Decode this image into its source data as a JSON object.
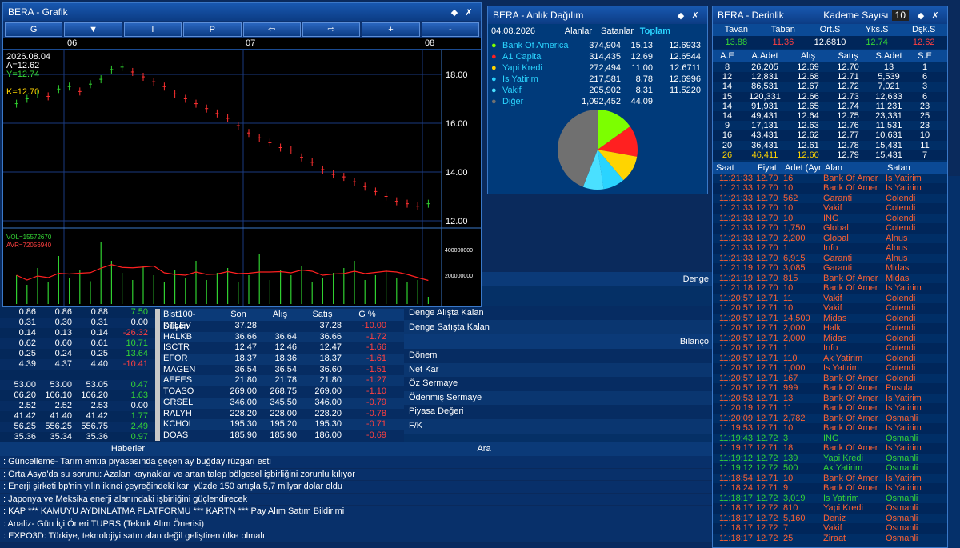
{
  "chart_win": {
    "title": "BERA - Grafik",
    "toolbar": [
      "G",
      "▼",
      "I",
      "P",
      "⇦",
      "⇨",
      "+",
      "-"
    ],
    "dates": [
      "06",
      "07",
      "08"
    ],
    "ohlc_info": {
      "date": "2026.08.04",
      "a": "A=12.62",
      "y": "Y=12.74",
      "k": "K=12.70"
    },
    "price_ticks": [
      "18.00",
      "16.00",
      "14.00",
      "12.00"
    ],
    "vol_label": "VOL=15572670",
    "avr_label": "AVR=72056940",
    "vol_ticks": [
      "400000000",
      "200000000"
    ]
  },
  "chart_data": {
    "type": "line",
    "title": "",
    "series": [
      {
        "values": [
          16.8,
          17.0,
          17.2,
          17.1,
          17.4,
          17.5,
          17.3,
          17.6,
          17.8,
          18.2,
          18.3,
          18.1,
          17.9,
          17.7,
          17.5,
          17.2,
          17.0,
          16.8,
          16.6,
          16.4,
          16.2,
          15.9,
          15.6,
          15.4,
          15.2,
          15.0,
          14.9,
          14.6,
          14.4,
          14.1,
          13.9,
          13.8,
          13.6,
          13.4,
          13.2,
          13.0,
          12.8,
          12.7,
          12.6,
          12.7
        ]
      },
      {
        "values": [
          120,
          80,
          150,
          90,
          200,
          110,
          140,
          95,
          260,
          180,
          130,
          100,
          160,
          120,
          90,
          140,
          110,
          180,
          100,
          130,
          150,
          90,
          120,
          210,
          100,
          140,
          120,
          160,
          90,
          110,
          130,
          150,
          180,
          100,
          120,
          140,
          110,
          90,
          100,
          30
        ]
      }
    ]
  },
  "dist_win": {
    "title": "BERA - Anlık Dağılım",
    "date": "04.08.2026",
    "headers": [
      "Alanlar",
      "Satanlar",
      "Toplam"
    ],
    "rows": [
      {
        "name": "Bank Of America",
        "a": "374,904",
        "b": "15.13",
        "c": "12.6933",
        "color": "#7cff00"
      },
      {
        "name": "A1 Capital",
        "a": "314,435",
        "b": "12.69",
        "c": "12.6544",
        "color": "#ff2020"
      },
      {
        "name": "Yapi Kredi",
        "a": "272,494",
        "b": "11.00",
        "c": "12.6711",
        "color": "#ffd400"
      },
      {
        "name": "Is Yatirim",
        "a": "217,581",
        "b": "8.78",
        "c": "12.6996",
        "color": "#2ad4ff"
      },
      {
        "name": "Vakif",
        "a": "205,902",
        "b": "8.31",
        "c": "11.5220",
        "color": "#4ae0ff"
      },
      {
        "name": "Diğer",
        "a": "1,092,452",
        "b": "44.09",
        "c": "",
        "color": "#707070"
      }
    ]
  },
  "depth_win": {
    "title": "BERA - Derinlik",
    "kademe_label": "Kademe Sayısı",
    "kademe_value": "10",
    "top_headers": [
      "Tavan",
      "Taban",
      "Ort.S",
      "Yks.S",
      "Dşk.S"
    ],
    "top_values": [
      "13.88",
      "11.36",
      "12.6810",
      "12.74",
      "12.62"
    ],
    "book_headers": [
      "A.E",
      "A.Adet",
      "Alış",
      "Satış",
      "S.Adet",
      "S.E"
    ],
    "book": [
      [
        "8",
        "26,205",
        "12.69",
        "12.70",
        "13",
        "1"
      ],
      [
        "12",
        "12,831",
        "12.68",
        "12.71",
        "5,539",
        "6"
      ],
      [
        "14",
        "86,531",
        "12.67",
        "12.72",
        "7,021",
        "3"
      ],
      [
        "15",
        "120,331",
        "12.66",
        "12.73",
        "12,633",
        "6"
      ],
      [
        "14",
        "91,931",
        "12.65",
        "12.74",
        "11,231",
        "23"
      ],
      [
        "14",
        "49,431",
        "12.64",
        "12.75",
        "23,331",
        "25"
      ],
      [
        "9",
        "17,131",
        "12.63",
        "12.76",
        "11,531",
        "23"
      ],
      [
        "16",
        "43,431",
        "12.62",
        "12.77",
        "10,631",
        "10"
      ],
      [
        "20",
        "36,431",
        "12.61",
        "12.78",
        "15,431",
        "11"
      ],
      [
        "26",
        "46,411",
        "12.60",
        "12.79",
        "15,431",
        "7"
      ]
    ],
    "trade_headers": [
      "Saat",
      "Fiyat",
      "Adet (Ayrık)",
      "Alan",
      "Satan"
    ],
    "trades": [
      [
        "11:21:33",
        "12.70",
        "16",
        "Bank Of Amer",
        "Is Yatirim",
        "r"
      ],
      [
        "11:21:33",
        "12.70",
        "10",
        "Bank Of Amer",
        "Is Yatirim",
        "r"
      ],
      [
        "11:21:33",
        "12.70",
        "562",
        "Garanti",
        "Colendi",
        "r"
      ],
      [
        "11:21:33",
        "12.70",
        "10",
        "Vakif",
        "Colendi",
        "r"
      ],
      [
        "11:21:33",
        "12.70",
        "10",
        "ING",
        "Colendi",
        "r"
      ],
      [
        "11:21:33",
        "12.70",
        "1,750",
        "Global",
        "Colendi",
        "r"
      ],
      [
        "11:21:33",
        "12.70",
        "2,200",
        "Global",
        "Alnus",
        "r"
      ],
      [
        "11:21:33",
        "12.70",
        "1",
        "Info",
        "Alnus",
        "r"
      ],
      [
        "11:21:33",
        "12.70",
        "6,915",
        "Garanti",
        "Alnus",
        "r"
      ],
      [
        "11:21:19",
        "12.70",
        "3,085",
        "Garanti",
        "Midas",
        "r"
      ],
      [
        "11:21:19",
        "12.70",
        "815",
        "Bank Of Amer",
        "Midas",
        "r"
      ],
      [
        "11:21:18",
        "12.70",
        "10",
        "Bank Of Amer",
        "Is Yatirim",
        "r"
      ],
      [
        "11:20:57",
        "12.71",
        "11",
        "Vakif",
        "Colendi",
        "r"
      ],
      [
        "11:20:57",
        "12.71",
        "10",
        "Vakif",
        "Colendi",
        "r"
      ],
      [
        "11:20:57",
        "12.71",
        "14,500",
        "Midas",
        "Colendi",
        "r"
      ],
      [
        "11:20:57",
        "12.71",
        "2,000",
        "Halk",
        "Colendi",
        "r"
      ],
      [
        "11:20:57",
        "12.71",
        "2,000",
        "Midas",
        "Colendi",
        "r"
      ],
      [
        "11:20:57",
        "12.71",
        "1",
        "Info",
        "Colendi",
        "r"
      ],
      [
        "11:20:57",
        "12.71",
        "110",
        "Ak Yatirim",
        "Colendi",
        "r"
      ],
      [
        "11:20:57",
        "12.71",
        "1,000",
        "Is Yatirim",
        "Colendi",
        "r"
      ],
      [
        "11:20:57",
        "12.71",
        "167",
        "Bank Of Amer",
        "Colendi",
        "r"
      ],
      [
        "11:20:57",
        "12.71",
        "999",
        "Bank Of Amer",
        "Pusula",
        "r"
      ],
      [
        "11:20:53",
        "12.71",
        "13",
        "Bank Of Amer",
        "Is Yatirim",
        "r"
      ],
      [
        "11:20:19",
        "12.71",
        "11",
        "Bank Of Amer",
        "Is Yatirim",
        "r"
      ],
      [
        "11:20:09",
        "12.71",
        "2,782",
        "Bank Of Amer",
        "Osmanli",
        "r"
      ],
      [
        "11:19:53",
        "12.71",
        "10",
        "Bank Of Amer",
        "Is Yatirim",
        "r"
      ],
      [
        "11:19:43",
        "12.72",
        "3",
        "ING",
        "Osmanli",
        "g"
      ],
      [
        "11:19:17",
        "12.71",
        "18",
        "Bank Of Amer",
        "Is Yatirim",
        "r"
      ],
      [
        "11:19:12",
        "12.72",
        "139",
        "Yapi Kredi",
        "Osmanli",
        "g"
      ],
      [
        "11:19:12",
        "12.72",
        "500",
        "Ak Yatirim",
        "Osmanli",
        "g"
      ],
      [
        "11:18:54",
        "12.71",
        "10",
        "Bank Of Amer",
        "Is Yatirim",
        "r"
      ],
      [
        "11:18:24",
        "12.71",
        "9",
        "Bank Of Amer",
        "Is Yatirim",
        "r"
      ],
      [
        "11:18:17",
        "12.72",
        "3,019",
        "Is Yatirim",
        "Osmanli",
        "g"
      ],
      [
        "11:18:17",
        "12.72",
        "810",
        "Yapi Kredi",
        "Osmanli",
        "r"
      ],
      [
        "11:18:17",
        "12.72",
        "5,160",
        "Deniz",
        "Osmanli",
        "r"
      ],
      [
        "11:18:17",
        "12.72",
        "7",
        "Vakif",
        "Osmanli",
        "r"
      ],
      [
        "11:18:17",
        "12.72",
        "25",
        "Ziraat",
        "Osmanli",
        "r"
      ]
    ]
  },
  "left_rows": [
    [
      "0.86",
      "0.86",
      "0.88",
      "7.50",
      "g"
    ],
    [
      "0.31",
      "0.30",
      "0.31",
      "0.00",
      "w"
    ],
    [
      "0.14",
      "0.13",
      "0.14",
      "-26.32",
      "r"
    ],
    [
      "0.62",
      "0.60",
      "0.61",
      "10.71",
      "g"
    ],
    [
      "0.25",
      "0.24",
      "0.25",
      "13.64",
      "g"
    ],
    [
      "4.39",
      "4.37",
      "4.40",
      "-10.41",
      "r"
    ],
    [
      "",
      "",
      "",
      "",
      ""
    ],
    [
      "53.00",
      "53.00",
      "53.05",
      "0.47",
      "g"
    ],
    [
      "06.20",
      "106.10",
      "106.20",
      "1.63",
      "g"
    ],
    [
      "2.52",
      "2.52",
      "2.53",
      "0.00",
      "w"
    ],
    [
      "41.42",
      "41.40",
      "41.42",
      "1.77",
      "g"
    ],
    [
      "56.25",
      "556.25",
      "556.75",
      "2.49",
      "g"
    ],
    [
      "35.36",
      "35.34",
      "35.36",
      "0.97",
      "g"
    ]
  ],
  "losers": {
    "headers": [
      "Bist100-Düşen",
      "Son",
      "Alış",
      "Satış",
      "G %"
    ],
    "rows": [
      [
        "KTLEV",
        "37.28",
        "",
        "37.28",
        "-10.00"
      ],
      [
        "HALKB",
        "36.66",
        "36.64",
        "36.66",
        "-1.72"
      ],
      [
        "ISCTR",
        "12.47",
        "12.46",
        "12.47",
        "-1.66"
      ],
      [
        "EFOR",
        "18.37",
        "18.36",
        "18.37",
        "-1.61"
      ],
      [
        "MAGEN",
        "36.54",
        "36.54",
        "36.60",
        "-1.51"
      ],
      [
        "AEFES",
        "21.80",
        "21.78",
        "21.80",
        "-1.27"
      ],
      [
        "TOASO",
        "269.00",
        "268.75",
        "269.00",
        "-1.10"
      ],
      [
        "GRSEL",
        "346.00",
        "345.50",
        "346.00",
        "-0.79"
      ],
      [
        "RALYH",
        "228.20",
        "228.00",
        "228.20",
        "-0.78"
      ],
      [
        "KCHOL",
        "195.30",
        "195.20",
        "195.30",
        "-0.71"
      ],
      [
        "DOAS",
        "185.90",
        "185.90",
        "186.00",
        "-0.69"
      ]
    ]
  },
  "balance": {
    "denge": "Denge",
    "bilanco": "Bilanço",
    "items1": [
      "Denge Alışta Kalan",
      "Denge Satışta Kalan"
    ],
    "items2": [
      "Dönem",
      "Net Kar",
      "Öz Sermaye",
      "Ödenmiş Sermaye",
      "Piyasa Değeri",
      "F/K"
    ]
  },
  "news": {
    "header": "Haberler",
    "search": "Ara",
    "items": [
      ": Güncelleme- Tarım emtia piyasasında geçen ay buğday rüzgarı esti",
      ": Orta Asya'da su sorunu: Azalan kaynaklar ve artan talep bölgesel işbirliğini zorunlu kılıyor",
      ": Enerji şirketi bp'nin yılın ikinci çeyreğindeki karı yüzde 150 artışla 5,7 milyar dolar oldu",
      ": Japonya ve Meksika enerji alanındaki işbirliğini güçlendirecek",
      ": KAP *** KAMUYU AYDINLATMA PLATFORMU *** KARTN *** Pay Alım Satım Bildirimi",
      ": Analiz- Gün İçi Öneri TUPRS (Teknik Alım Önerisi)",
      ": EXPO3D: Türkiye, teknolojiyi satın alan değil geliştiren ülke olmalı"
    ]
  },
  "colors": {
    "bg": "#0a2a5c",
    "panel": "#003a7a",
    "up": "#35d535",
    "down": "#ff4040"
  }
}
